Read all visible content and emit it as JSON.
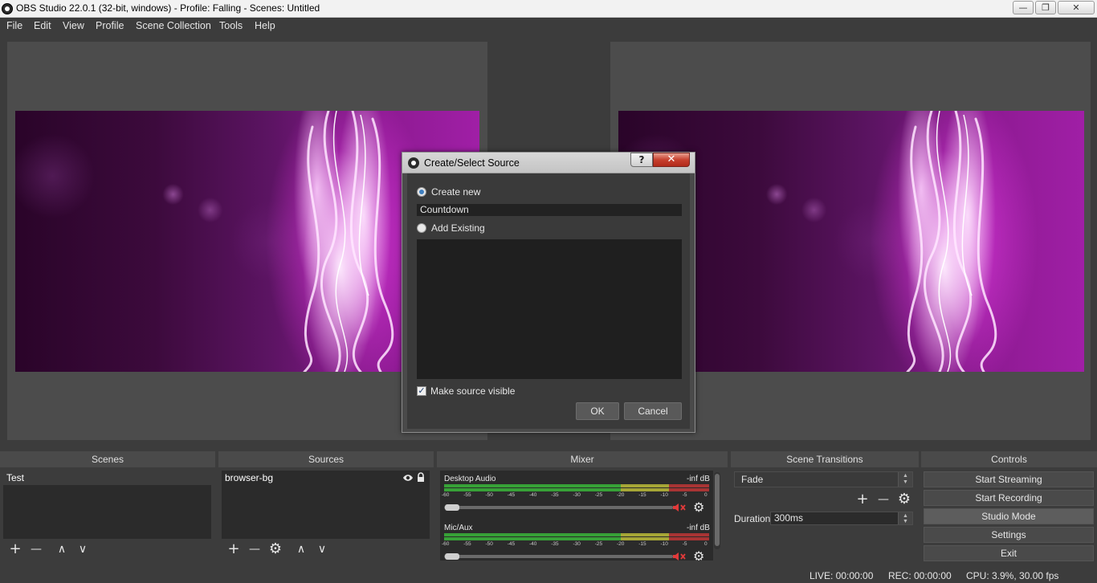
{
  "window": {
    "title": "OBS Studio 22.0.1 (32-bit, windows) - Profile: Falling - Scenes: Untitled",
    "minimize_glyph": "—",
    "maximize_glyph": "❐",
    "close_glyph": "✕"
  },
  "menubar": [
    "File",
    "Edit",
    "View",
    "Profile",
    "Scene Collection",
    "Tools",
    "Help"
  ],
  "dialog": {
    "title": "Create/Select Source",
    "help_glyph": "?",
    "close_glyph": "✕",
    "create_new_label": "Create new",
    "source_name_value": "Countdown",
    "add_existing_label": "Add Existing",
    "make_visible_label": "Make source visible",
    "make_visible_checked": true,
    "check_glyph": "✓",
    "ok_label": "OK",
    "cancel_label": "Cancel"
  },
  "docks": {
    "scenes": {
      "title": "Scenes",
      "items": [
        "Test"
      ]
    },
    "sources": {
      "title": "Sources",
      "items": [
        "browser-bg"
      ]
    },
    "mixer": {
      "title": "Mixer",
      "channels": [
        {
          "name": "Desktop Audio",
          "level": "-inf dB"
        },
        {
          "name": "Mic/Aux",
          "level": "-inf dB"
        }
      ],
      "ticks": [
        "-60",
        "-55",
        "-50",
        "-45",
        "-40",
        "-35",
        "-30",
        "-25",
        "-20",
        "-15",
        "-10",
        "-5",
        "0"
      ]
    },
    "transitions": {
      "title": "Scene Transitions",
      "selected": "Fade",
      "duration_label": "Duration",
      "duration_value": "300ms"
    },
    "controls": {
      "title": "Controls",
      "buttons": [
        "Start Streaming",
        "Start Recording",
        "Studio Mode",
        "Settings",
        "Exit"
      ]
    }
  },
  "toolbar_glyphs": {
    "add": "+",
    "remove": "—",
    "up": "∧",
    "down": "∨",
    "gear": "⚙"
  },
  "status": {
    "live": "LIVE: 00:00:00",
    "rec": "REC: 00:00:00",
    "cpu": "CPU: 3.9%, 30.00 fps"
  },
  "colors": {
    "accent": "#3f7fbf",
    "mute_red": "#e13a3a",
    "meter_green": "#37a137",
    "meter_yellow": "#a6a636",
    "meter_red": "#a83434"
  }
}
